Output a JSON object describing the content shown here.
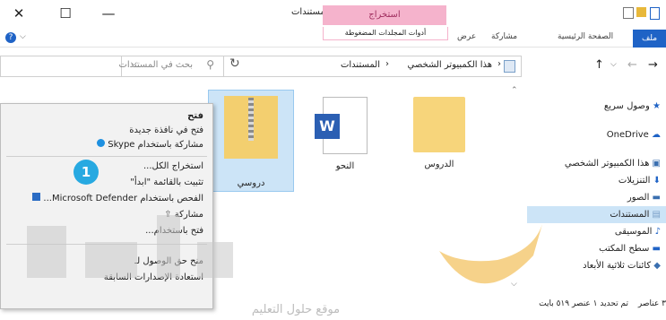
{
  "window": {
    "title": "المستندات"
  },
  "ribbon": {
    "context_tab": "استخراج",
    "context_sub": "أدوات المجلدات المضغوطة",
    "tabs": {
      "file": "ملف",
      "home": "الصفحة الرئيسية",
      "share": "مشاركة",
      "view": "عرض"
    }
  },
  "address": {
    "path": [
      "هذا الكمبيوتر الشخصي",
      "المستندات"
    ],
    "search_placeholder": "بحث في المستندات"
  },
  "nav": {
    "items": [
      {
        "label": "وصول سريع",
        "icon": "star-icon"
      },
      {
        "label": "OneDrive",
        "icon": "cloud-icon"
      },
      {
        "label": "هذا الكمبيوتر الشخصي",
        "icon": "computer-icon"
      },
      {
        "label": "التنزيلات",
        "icon": "download-icon"
      },
      {
        "label": "الصور",
        "icon": "pictures-icon"
      },
      {
        "label": "المستندات",
        "icon": "documents-icon",
        "selected": true
      },
      {
        "label": "الموسيقى",
        "icon": "music-icon"
      },
      {
        "label": "سطح المكتب",
        "icon": "desktop-icon"
      },
      {
        "label": "كائنات ثلاثية الأبعاد",
        "icon": "objects-3d-icon"
      }
    ]
  },
  "files": [
    {
      "name": "الدروس",
      "type": "folder"
    },
    {
      "name": "النحو",
      "type": "word"
    },
    {
      "name": "دروسي",
      "type": "zip"
    }
  ],
  "context_menu": {
    "group1": [
      "فتح",
      "فتح في نافذة جديدة",
      "مشاركة باستخدام Skype"
    ],
    "group2": [
      "استخراج الكل...",
      "تثبيت بالقائمة \"ابدأ\"",
      "الفحص باستخدام Microsoft Defender...",
      "مشاركة",
      "فتح باستخدام..."
    ],
    "group3": [
      "منح حق الوصول لـ",
      "استعادة الإصدارات السابقة"
    ]
  },
  "callout": {
    "number": "1"
  },
  "status": {
    "items": "٣ عناصر",
    "selected": "تم تحديد ١ عنصر ٥١٩ بايت"
  },
  "watermark": {
    "text": "موقع حلول التعليم"
  },
  "colors": {
    "accent": "#1f63c6",
    "context_tab": "#f5b3cc",
    "selection": "#cce4f7",
    "callout": "#27a9e1"
  }
}
